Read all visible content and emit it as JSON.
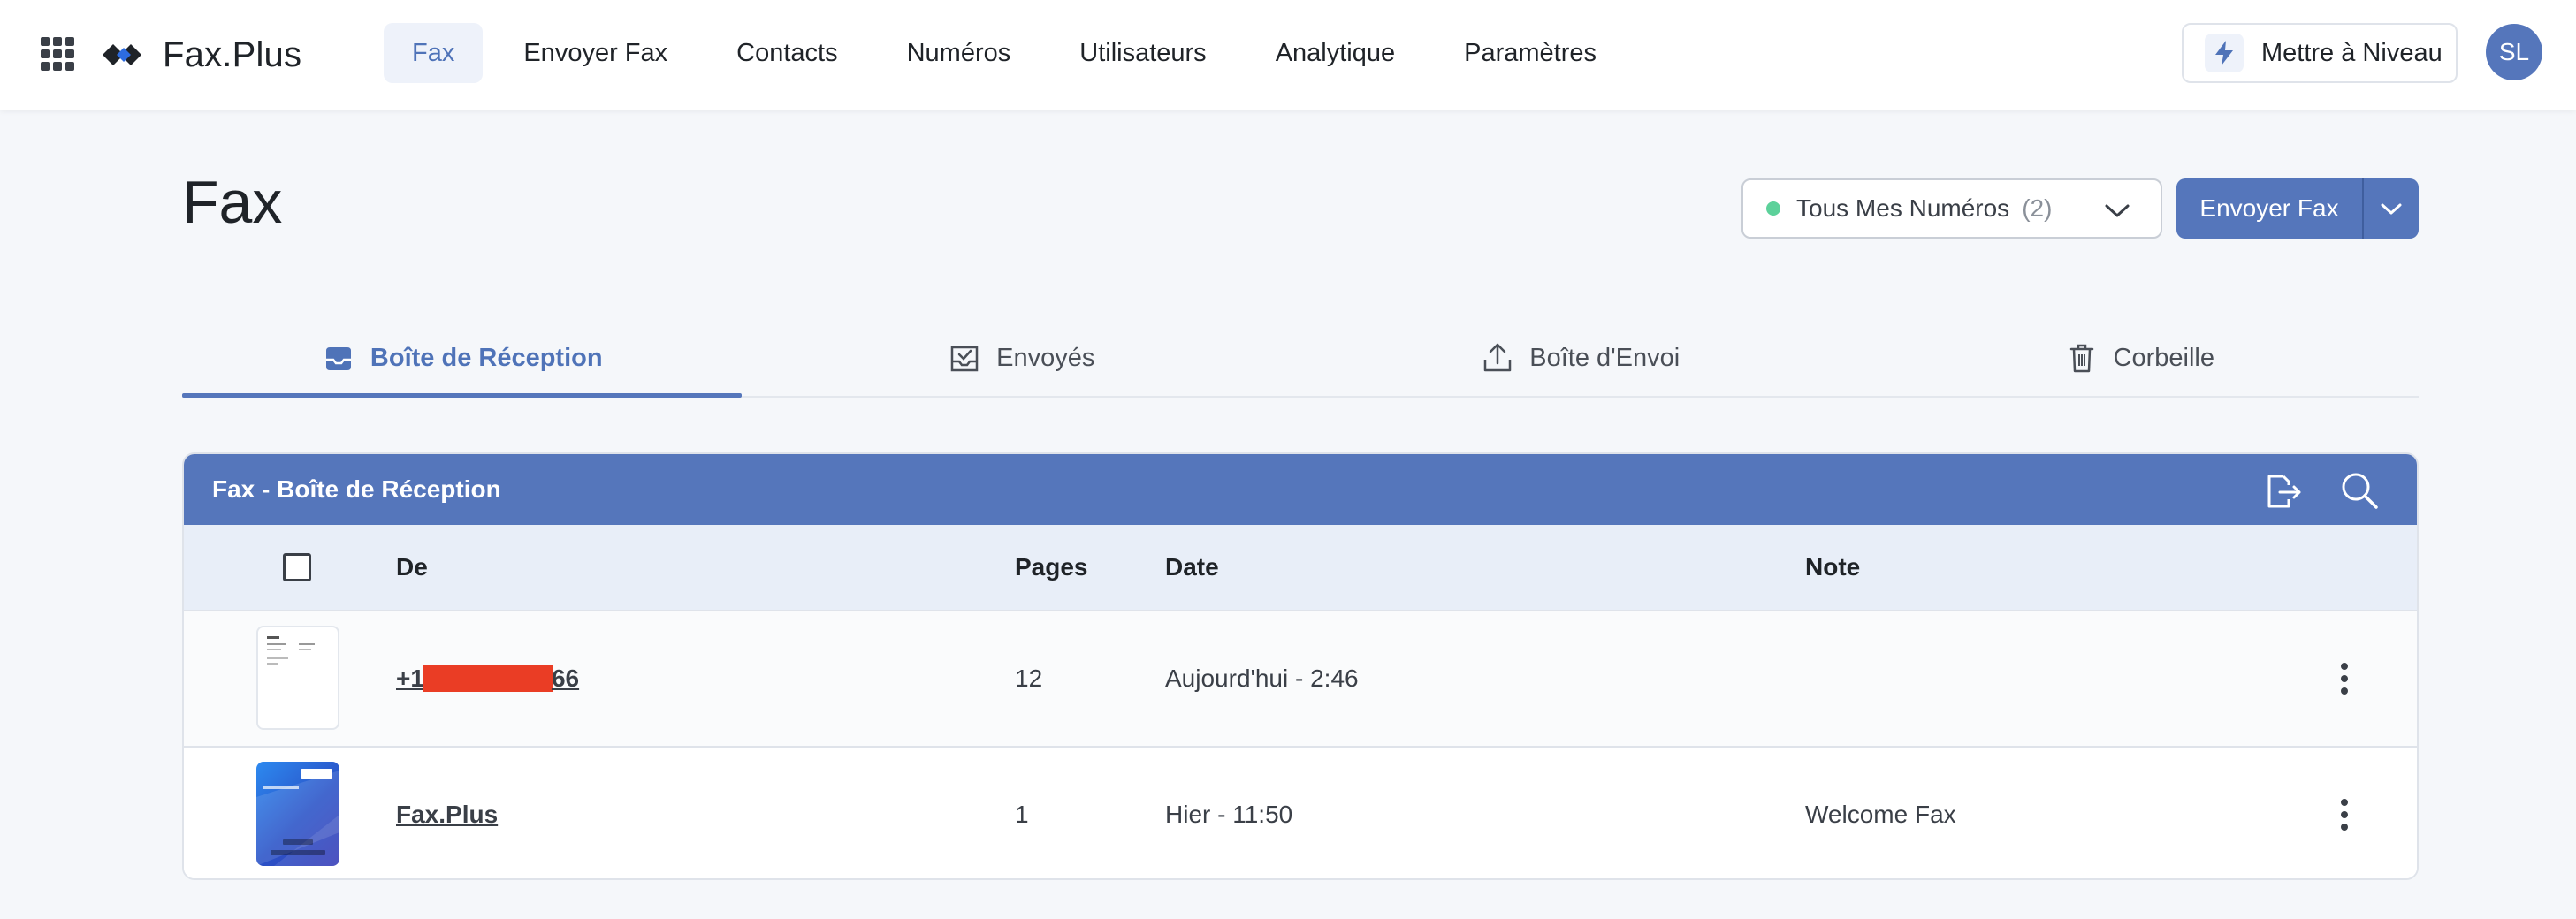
{
  "topbar": {
    "brand_name": "Fax.Plus",
    "nav": [
      {
        "label": "Fax",
        "active": true
      },
      {
        "label": "Envoyer Fax",
        "active": false
      },
      {
        "label": "Contacts",
        "active": false
      },
      {
        "label": "Numéros",
        "active": false
      },
      {
        "label": "Utilisateurs",
        "active": false
      },
      {
        "label": "Analytique",
        "active": false
      },
      {
        "label": "Paramètres",
        "active": false
      }
    ],
    "upgrade_label": "Mettre à Niveau",
    "avatar_initials": "SL"
  },
  "page": {
    "title": "Fax",
    "number_select": {
      "label": "Tous Mes Numéros",
      "count": "(2)"
    },
    "send_button": "Envoyer Fax"
  },
  "tabs": [
    {
      "label": "Boîte de Réception",
      "icon": "inbox-icon",
      "active": true
    },
    {
      "label": "Envoyés",
      "icon": "sent-icon",
      "active": false
    },
    {
      "label": "Boîte d'Envoi",
      "icon": "upload-icon",
      "active": false
    },
    {
      "label": "Corbeille",
      "icon": "trash-icon",
      "active": false
    }
  ],
  "table": {
    "title": "Fax - Boîte de Réception",
    "columns": {
      "from": "De",
      "pages": "Pages",
      "date": "Date",
      "note": "Note"
    },
    "rows": [
      {
        "from_prefix": "+1 ",
        "from_suffix": "66",
        "pages": "12",
        "date": "Aujourd'hui - 2:46",
        "note": ""
      },
      {
        "from": "Fax.Plus",
        "pages": "1",
        "date": "Hier - 11:50",
        "note": "Welcome Fax"
      }
    ]
  },
  "colors": {
    "accent": "#5576bb",
    "active_tab_text": "#4f73b8",
    "header_row_bg": "#e8eef8",
    "status_dot": "#5cd19a",
    "redaction": "#ea3d25"
  }
}
